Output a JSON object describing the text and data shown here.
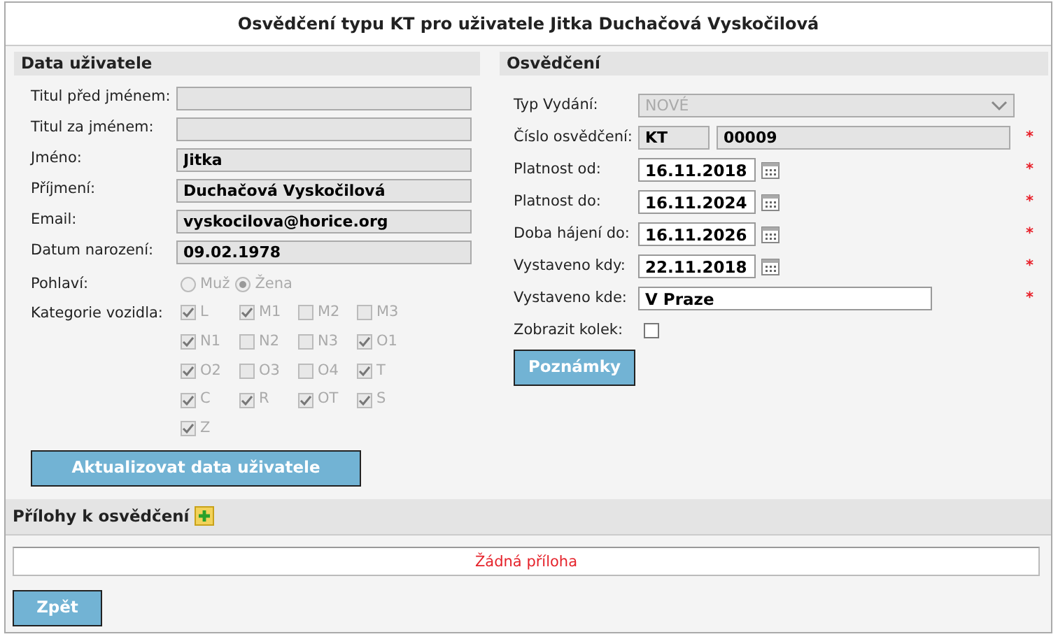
{
  "title": "Osvědčení typu KT pro uživatele Jitka Duchačová Vyskočilová",
  "user_section": {
    "heading": "Data uživatele",
    "fields": [
      {
        "label": "Titul před jménem:"
      },
      {
        "label": "Titul za jménem:"
      },
      {
        "label": "Jméno:",
        "value": "Jitka"
      },
      {
        "label": "Příjmení:",
        "value": "Duchačová Vyskočilová"
      },
      {
        "label": "Email:",
        "value": "vyskocilova@horice.org"
      },
      {
        "label": "Datum narození:",
        "value": "09.02.1978"
      }
    ],
    "gender": {
      "label": "Pohlaví:",
      "options": [
        {
          "label": "Muž",
          "selected": false
        },
        {
          "label": "Žena",
          "selected": true
        }
      ]
    },
    "categories": {
      "label": "Kategorie vozidla:",
      "items": [
        {
          "label": "L",
          "checked": true
        },
        {
          "label": "M1",
          "checked": true
        },
        {
          "label": "M2",
          "checked": false
        },
        {
          "label": "M3",
          "checked": false
        },
        {
          "label": "N1",
          "checked": true
        },
        {
          "label": "N2",
          "checked": false
        },
        {
          "label": "N3",
          "checked": false
        },
        {
          "label": "O1",
          "checked": true
        },
        {
          "label": "O2",
          "checked": true
        },
        {
          "label": "O3",
          "checked": false
        },
        {
          "label": "O4",
          "checked": false
        },
        {
          "label": "T",
          "checked": true
        },
        {
          "label": "C",
          "checked": true
        },
        {
          "label": "R",
          "checked": true
        },
        {
          "label": "OT",
          "checked": true
        },
        {
          "label": "S",
          "checked": true
        },
        {
          "label": "Z",
          "checked": true
        }
      ]
    },
    "update_button": "Aktualizovat data uživatele"
  },
  "cert_section": {
    "heading": "Osvědčení",
    "rows": [
      {
        "kind": "select",
        "label": "Typ Vydání:",
        "value": "NOVÉ",
        "required": false
      },
      {
        "kind": "pair",
        "label": "Číslo osvědčení:",
        "prefix": "KT",
        "value": "00009",
        "required": true
      },
      {
        "kind": "date",
        "label": "Platnost od:",
        "value": "16.11.2018",
        "required": true
      },
      {
        "kind": "date",
        "label": "Platnost do:",
        "value": "16.11.2024",
        "required": true
      },
      {
        "kind": "date",
        "label": "Doba hájení do:",
        "value": "16.11.2026",
        "required": true
      },
      {
        "kind": "date",
        "label": "Vystaveno kdy:",
        "value": "22.11.2018",
        "required": true
      },
      {
        "kind": "text",
        "label": "Vystaveno kde:",
        "value": "V Praze",
        "required": true
      },
      {
        "kind": "checkbox",
        "label": "Zobrazit kolek:",
        "checked": false,
        "required": false
      }
    ],
    "required_mark": "*",
    "notes_button": "Poznámky"
  },
  "attachments": {
    "heading": "Přílohy k osvědčení",
    "empty_text": "Žádná příloha"
  },
  "back_button": "Zpět"
}
